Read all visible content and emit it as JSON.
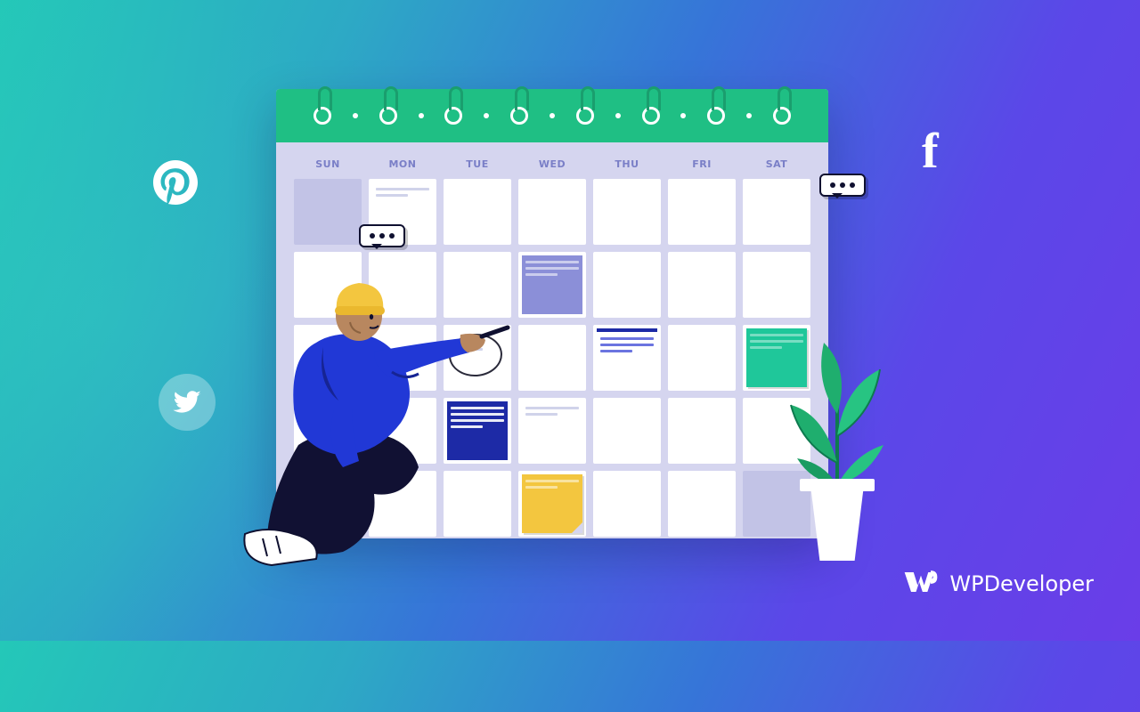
{
  "calendar": {
    "days": [
      "SUN",
      "MON",
      "TUE",
      "WED",
      "THU",
      "FRI",
      "SAT"
    ]
  },
  "brand": {
    "name": "WPDeveloper"
  },
  "icons": {
    "pinterest": "pinterest",
    "twitter": "twitter",
    "facebook": "f"
  }
}
